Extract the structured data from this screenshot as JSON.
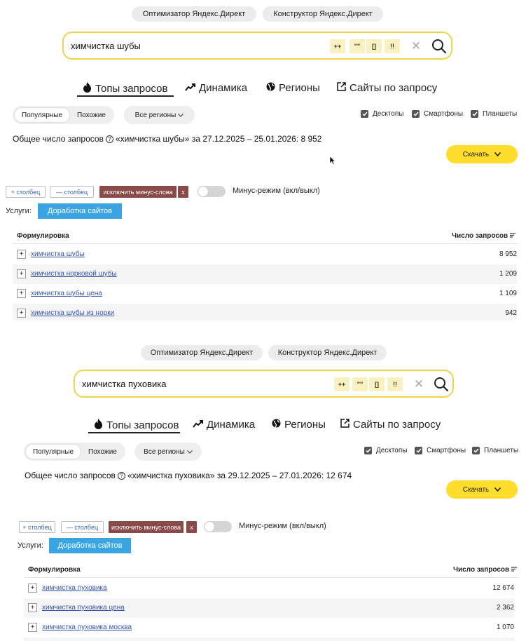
{
  "top_buttons": [
    "Оптимизатор Яндекс.Директ",
    "Конструктор Яндекс.Директ"
  ],
  "search_ops": [
    "++",
    "\"\"",
    "[]",
    "!!"
  ],
  "search_clear": "✕",
  "tabs": {
    "tops": "Топы запросов",
    "dynamics": "Динамика",
    "regions": "Регионы",
    "sites": "Сайты по запросу"
  },
  "segment": {
    "popular": "Популярные",
    "similar": "Похожие"
  },
  "region_select": "Все регионы",
  "devices": [
    "Десктопы",
    "Смартфоны",
    "Планшеты"
  ],
  "download": "Скачать",
  "toolbar": {
    "add_col": "+ столбец",
    "remove_col": "— столбец",
    "exclude_minus": "исключить минус-слова",
    "x": "x",
    "minus_mode": "Минус-режим (вкл/выкл)"
  },
  "services": {
    "label": "Услуги:",
    "button": "Доработка сайтов"
  },
  "table_headers": {
    "phrase": "Формулировка",
    "count": "Число запросов"
  },
  "plus_sign": "+",
  "panels": [
    {
      "query": "химчистка шубы",
      "total_text": "Общее число запросов",
      "total_rest": "«химчистка шубы» за 27.12.2025 – 25.01.2026: 8 952",
      "rows": [
        {
          "phrase": "химчистка шубы",
          "count": "8 952"
        },
        {
          "phrase": "химчистка норковой шубы",
          "count": "1 209"
        },
        {
          "phrase": "химчистка шубы цена",
          "count": "1 109"
        },
        {
          "phrase": "химчистка шубы из норки",
          "count": "942"
        }
      ]
    },
    {
      "query": "химчистка пуховика",
      "total_text": "Общее число запросов",
      "total_rest": "«химчистка пуховика» за 29.12.2025 – 27.01.2026: 12 674",
      "rows": [
        {
          "phrase": "химчистка пуховика",
          "count": "12 674"
        },
        {
          "phrase": "химчистка пуховика цена",
          "count": "2 362"
        },
        {
          "phrase": "химчистка пуховика москва",
          "count": "1 070"
        }
      ]
    }
  ]
}
